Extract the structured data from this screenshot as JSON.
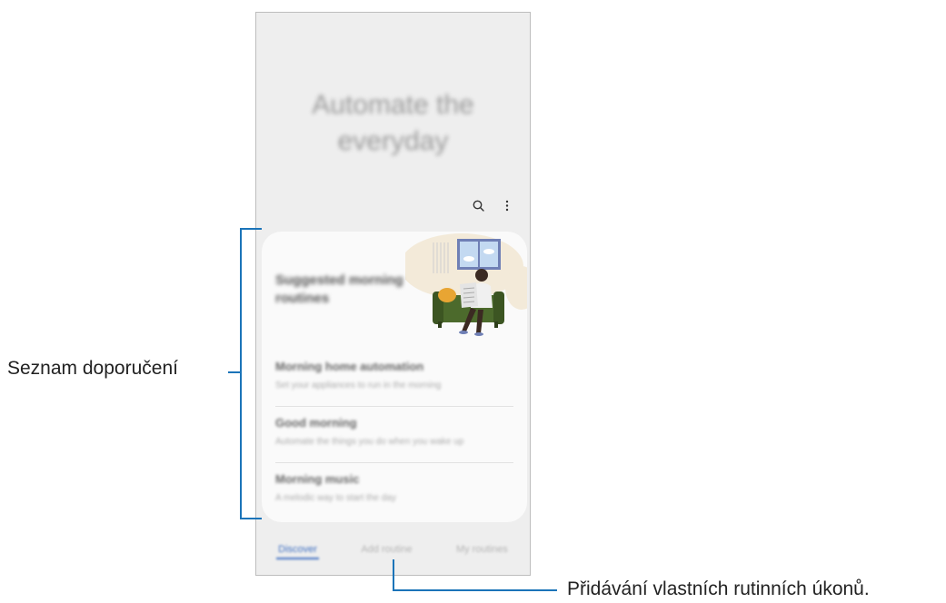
{
  "hero": {
    "title_line1": "Automate the",
    "title_line2": "everyday"
  },
  "toolbar": {
    "search_icon": "search-icon",
    "more_icon": "more-vertical-icon"
  },
  "card": {
    "title": "Suggested morning routines",
    "items": [
      {
        "title": "Morning home automation",
        "subtitle": "Set your appliances to run in the morning"
      },
      {
        "title": "Good morning",
        "subtitle": "Automate the things you do when you wake up"
      },
      {
        "title": "Morning music",
        "subtitle": "A melodic way to start the day"
      }
    ]
  },
  "tabs": {
    "discover": "Discover",
    "add_routine": "Add routine",
    "my_routines": "My routines"
  },
  "annotations": {
    "recommendation_list": "Seznam doporučení",
    "add_custom_routines": "Přidávání vlastních rutinních úkonů."
  },
  "colors": {
    "accent": "#1b74b9",
    "tab_active": "#3e6fc2",
    "sofa": "#4c6a2c",
    "sofa_dark": "#3c5522",
    "window_frame": "#6f7fb5",
    "pillow": "#e8a533"
  }
}
